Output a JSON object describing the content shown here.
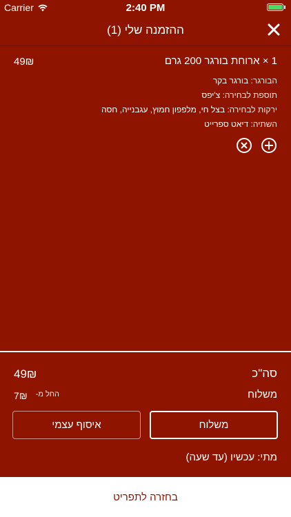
{
  "status_bar": {
    "carrier": "Carrier",
    "time": "2:40 PM"
  },
  "header": {
    "title": "ההזמנה שלי (1)"
  },
  "cart": {
    "item": {
      "name": "1 × ארוחת בורגר 200 גרם",
      "price": "49₪",
      "options": [
        {
          "label": "הבורגר:",
          "value": "בורגר בקר"
        },
        {
          "label": "תוספת לבחירה:",
          "value": "צ'יפס"
        },
        {
          "label": "ירקות לבחירה:",
          "value": "בצל חי, מלפפון חמוץ, עגבנייה, חסה"
        },
        {
          "label": "השתיה:",
          "value": "דיאט ספרייט"
        }
      ]
    }
  },
  "summary": {
    "total_label": "סה\"כ",
    "total_value": "49₪",
    "delivery_label": "משלוח",
    "delivery_from": "החל מ-",
    "delivery_value": "7₪"
  },
  "buttons": {
    "delivery": "משלוח",
    "pickup": "איסוף עצמי"
  },
  "when": "מתי: עכשיו (עד שעה)",
  "footer": {
    "back_label": "בחזרה לתפריט"
  },
  "colors": {
    "background": "#8f1400",
    "battery": "#4cd964"
  }
}
